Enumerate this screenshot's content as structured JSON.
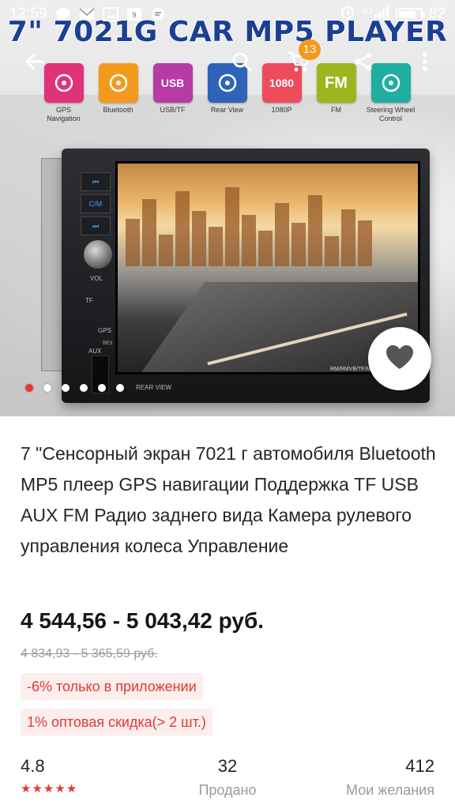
{
  "status_bar": {
    "time": "12:59",
    "network": "4G",
    "battery_level": "82",
    "battery_fraction": 0.82
  },
  "hero": {
    "banner_title": "7\" 7021G CAR MP5 PLAYER",
    "cart_count": "13",
    "features": [
      {
        "label": "GPS\nNavigation",
        "icon": "map-icon",
        "color": "#e0327a",
        "text": ""
      },
      {
        "label": "Bluetooth",
        "icon": "bluetooth-icon",
        "color": "#f39a1e",
        "text": ""
      },
      {
        "label": "USB/TF",
        "icon": "usb-icon",
        "color": "#b73aa5",
        "text": "USB"
      },
      {
        "label": "Rear View",
        "icon": "camera-icon",
        "color": "#2e63b8",
        "text": ""
      },
      {
        "label": "1080P",
        "icon": "hd-icon",
        "color": "#ee4b5c",
        "text": "1080"
      },
      {
        "label": "FM",
        "icon": "radio-icon",
        "color": "#9bb51c",
        "text": "FM"
      },
      {
        "label": "Steering Wheel\nControl",
        "icon": "steering-wheel-icon",
        "color": "#1fae9f",
        "text": ""
      }
    ],
    "device_labels": {
      "vol": "VOL",
      "tf": "TF",
      "gps": "GPS",
      "aux": "AUX",
      "res": "RES",
      "rear_view": "REAR VIEW",
      "model": "RM/RMVB/TF/MP5"
    },
    "carousel": {
      "count": 6,
      "active_index": 0
    }
  },
  "product": {
    "title": "7 \"Сенсорный экран 7021 г автомобиля Bluetooth MP5 плеер GPS навигации Поддержка TF USB AUX FM Радио заднего вида Камера рулевого управления колеса Управление",
    "price": "4 544,56 - 5 043,42 руб.",
    "old_price": "4 834,93 - 5 365,59 руб.",
    "promos": [
      "-6% только в приложении",
      "1% оптовая скидка(> 2 шт.)"
    ],
    "stats": {
      "rating": "4.8",
      "rating_stars": 5,
      "sold_count": "32",
      "sold_label": "Продано",
      "wishlist_count": "412",
      "wishlist_label": "Мои желания"
    }
  },
  "colors": {
    "accent_red": "#e53935",
    "promo_bg": "#fdeeee",
    "banner_blue": "#1b3f93",
    "badge_orange": "#f39a1e"
  }
}
